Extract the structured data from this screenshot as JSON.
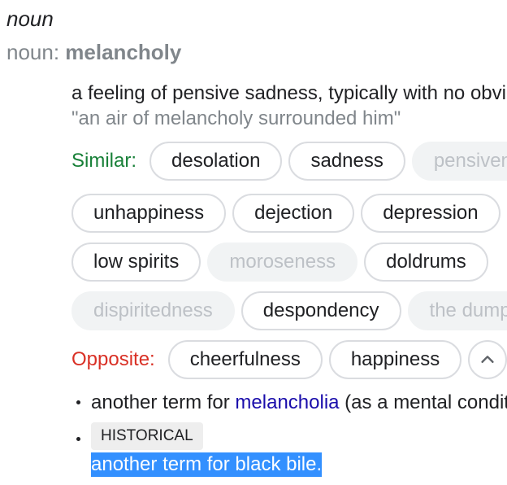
{
  "entry": {
    "part_of_speech": "noun",
    "subhead_prefix": "noun: ",
    "headword": "melancholy",
    "definition": "a feeling of pensive sadness, typically with no obvious cause.",
    "example": "\"an air of melancholy surrounded him\""
  },
  "similar": {
    "label": "Similar:",
    "rows": [
      [
        {
          "text": "desolation",
          "enabled": true
        },
        {
          "text": "sadness",
          "enabled": true
        },
        {
          "text": "pensiveness",
          "enabled": false
        }
      ],
      [
        {
          "text": "unhappiness",
          "enabled": true
        },
        {
          "text": "dejection",
          "enabled": true
        },
        {
          "text": "depression",
          "enabled": true
        }
      ],
      [
        {
          "text": "low spirits",
          "enabled": true
        },
        {
          "text": "moroseness",
          "enabled": false
        },
        {
          "text": "doldrums",
          "enabled": true
        }
      ],
      [
        {
          "text": "dispiritedness",
          "enabled": false
        },
        {
          "text": "despondency",
          "enabled": true
        },
        {
          "text": "the dumps",
          "enabled": false
        }
      ]
    ]
  },
  "opposite": {
    "label": "Opposite:",
    "chips": [
      {
        "text": "cheerfulness",
        "enabled": true
      },
      {
        "text": "happiness",
        "enabled": true
      }
    ],
    "more_icon": "chevron-up-icon"
  },
  "senses": [
    {
      "prefix": "another term for ",
      "link": "melancholia",
      "suffix": " (as a mental condition)."
    },
    {
      "badge": "HISTORICAL",
      "text": "another term for black bile."
    }
  ],
  "colors": {
    "similar_label": "#188038",
    "opposite_label": "#d93025",
    "link": "#1a0dab",
    "selection": "#3390ff"
  }
}
